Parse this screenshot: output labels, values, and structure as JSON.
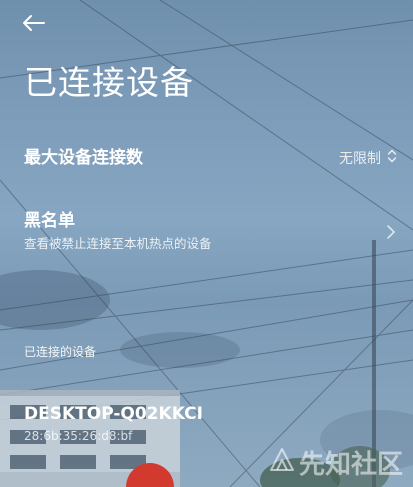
{
  "header": {
    "back_icon": "arrow-left-icon",
    "title": "已连接设备"
  },
  "settings": {
    "max_devices": {
      "label": "最大设备连接数",
      "value": "无限制",
      "icon": "up-down-chevron-icon"
    },
    "blacklist": {
      "label": "黑名单",
      "description": "查看被禁止连接至本机热点的设备",
      "icon": "chevron-right-icon"
    }
  },
  "connected_section": {
    "header": "已连接的设备",
    "devices": [
      {
        "name": "DESKTOP-Q02KKCI",
        "mac": "28:6b:35:26:d8:bf"
      }
    ]
  },
  "watermark": {
    "text": "先知社区",
    "icon": "xianzhi-logo-icon"
  },
  "colors": {
    "sky_top": "#6f90ad",
    "sky_mid": "#86a6c2",
    "text": "#ffffff"
  }
}
